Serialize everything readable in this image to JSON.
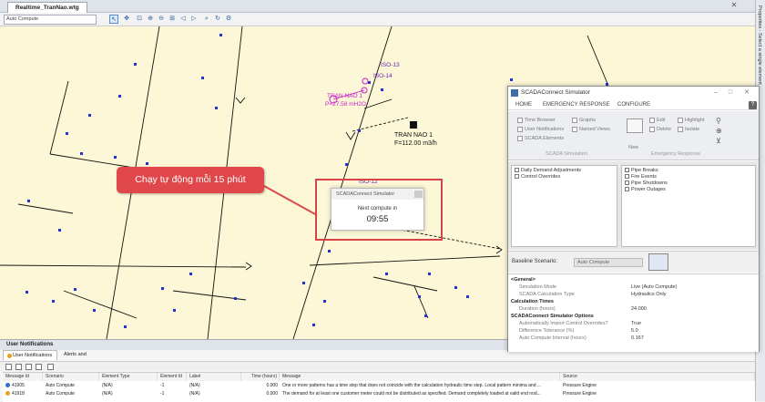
{
  "document_tab": {
    "label": "Realtime_TranNao.wtg"
  },
  "toolbar": {
    "scenario": "Auto Compute",
    "icons": [
      "select-icon",
      "pan-icon",
      "zoom-window-icon",
      "zoom-in-icon",
      "zoom-out-icon",
      "zoom-extents-icon",
      "zoom-previous-icon",
      "zoom-next-icon",
      "query-icon",
      "reset-icon",
      "settings-icon"
    ]
  },
  "right_strip": {
    "label": "Properties - Select a single element"
  },
  "annotation": {
    "text": "Chạy tự động mỗi 15 phút"
  },
  "map_labels": {
    "iso13": "ISO-13",
    "iso14": "ISO-14",
    "iso12": "ISO-12",
    "tran_nao_pump": "TRAN NAO 1",
    "pump_pressure": "P=27.58 mH2O",
    "tran_nao_meter": "TRAN NAO 1",
    "meter_flow": "F=112.00 m3/h"
  },
  "countdown_popup": {
    "title": "SCADAConnect Simulator",
    "next_compute": "Next compute in",
    "time": "09:55"
  },
  "notifications": {
    "title": "User Notifications",
    "tabs": [
      "User Notifications",
      "Alerts and Alarms"
    ],
    "columns": [
      "Message Id",
      "Scenario",
      "Element Type",
      "Element Id",
      "Label",
      "Time (hours)",
      "Message",
      "Source"
    ],
    "rows": [
      {
        "id": "41905",
        "scenario": "Auto Compute",
        "element_type": "(N/A)",
        "element_id": "-1",
        "label": "(N/A)",
        "time": "0.000",
        "message": "One or more patterns has a time step that does not coincide with the calculation hydraulic time step. Local pattern minima and ...",
        "source": "Pressure Engine"
      },
      {
        "id": "41918",
        "scenario": "Auto Compute",
        "element_type": "(N/A)",
        "element_id": "-1",
        "label": "(N/A)",
        "time": "0.000",
        "message": "The demand for at least one customer meter could not be distributed as specified. Demand completely loaded at valid end nod...",
        "source": "Pressure Engine"
      }
    ]
  },
  "simulator": {
    "title": "SCADAConnect Simulator",
    "menu": [
      "HOME",
      "EMERGENCY RESPONSE",
      "CONFIGURE"
    ],
    "ribbon": {
      "sim_buttons": [
        "Time Browser",
        "User Notifications",
        "SCADA Elements"
      ],
      "sim_buttons2": [
        "Graphs",
        "Named Views"
      ],
      "sim_group": "SCADA Simulation",
      "new_label": "New",
      "er_buttons": [
        "Edit",
        "Delete"
      ],
      "er_buttons2": [
        "Highlight",
        "Isolate"
      ],
      "er_group": "Emergency Response"
    },
    "left_events": [
      "Daily Demand Adjustments",
      "Control Overrides"
    ],
    "right_events": [
      "Pipe Breaks",
      "Fire Events",
      "Pipe Shutdowns",
      "Power Outages"
    ],
    "baseline": {
      "label": "Baseline Scenario:",
      "value": "Auto Compute"
    },
    "properties": {
      "general": "<General>",
      "simulation_mode": {
        "name": "Simulation Mode",
        "value": "Live (Auto Compute)"
      },
      "scada_calc_type": {
        "name": "SCADA Calculation Type",
        "value": "Hydraulics Only"
      },
      "calc_times": "Calculation Times",
      "duration": {
        "name": "Duration (hours)",
        "value": "24.000"
      },
      "options": "SCADAConnect Simulator Options",
      "auto_import": {
        "name": "Automatically Import Control Overrides?",
        "value": "True"
      },
      "diff_tol": {
        "name": "Difference Tolerance (%)",
        "value": "5.0"
      },
      "auto_interval": {
        "name": "Auto Compute Interval (hours)",
        "value": "0.167"
      }
    }
  },
  "colors": {
    "canvas": "#fcf7d6",
    "annotation": "#e0474a",
    "callout": "#d84348",
    "label_magenta": "#c71fc7",
    "node_blue": "#2233cc"
  }
}
